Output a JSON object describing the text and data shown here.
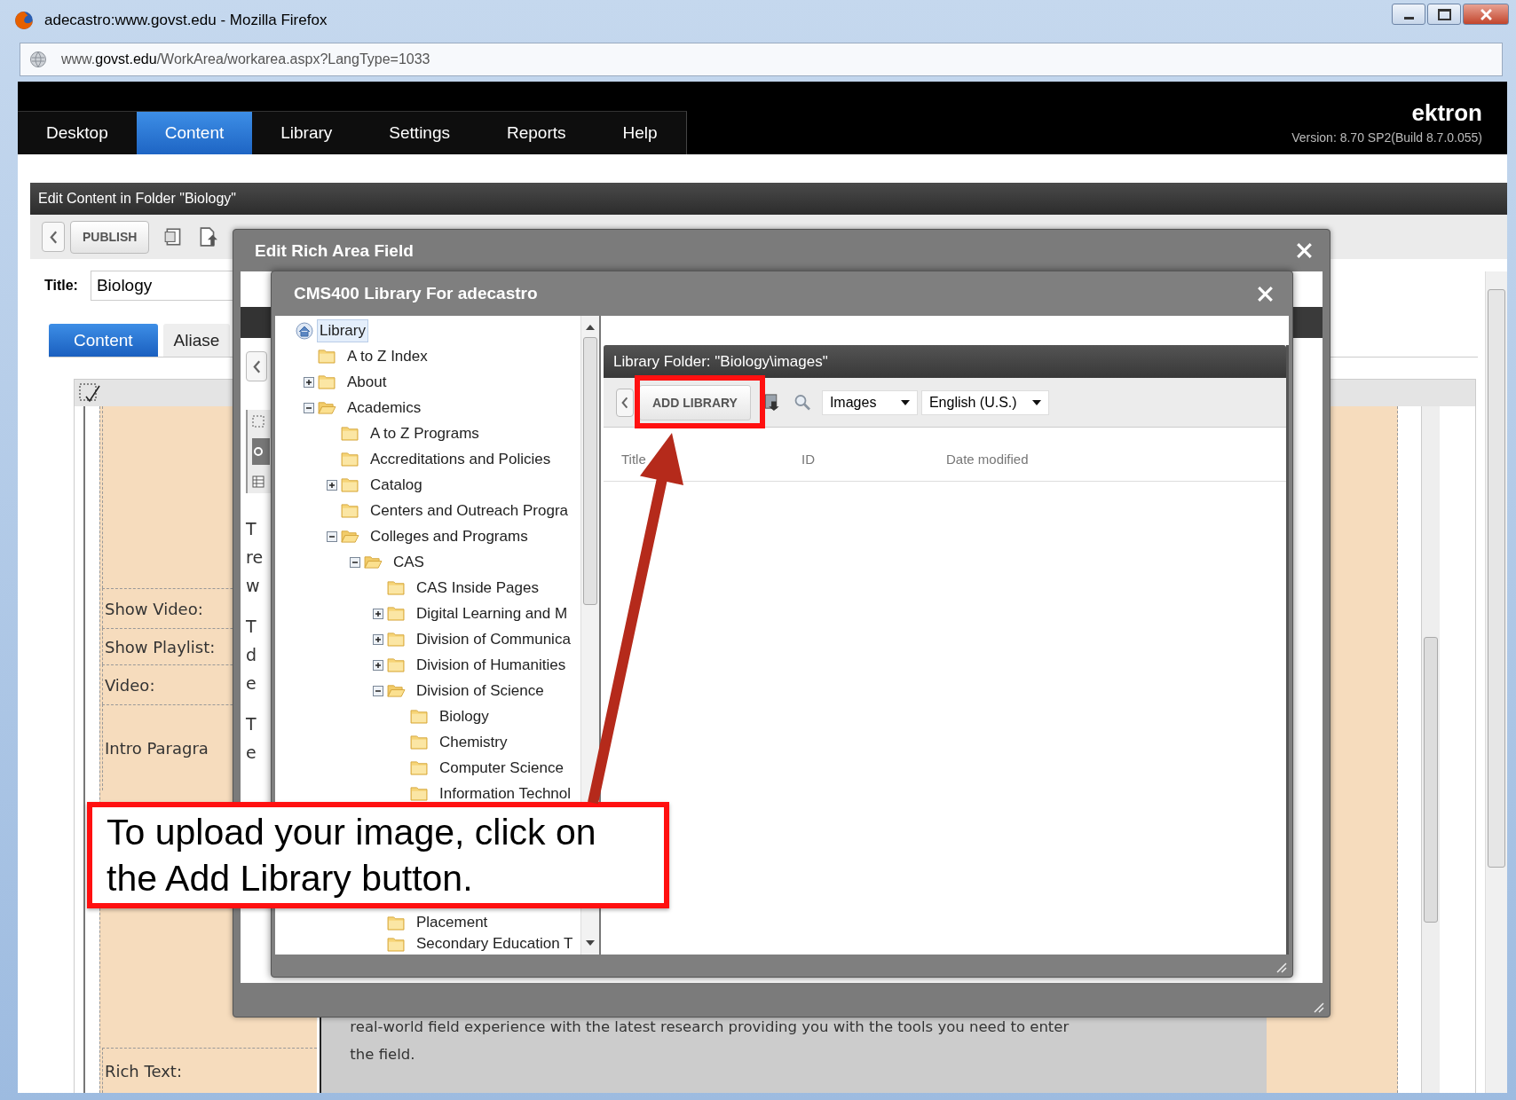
{
  "window": {
    "title": "adecastro:www.govst.edu - Mozilla Firefox"
  },
  "address_bar": {
    "url": "www.**govst.edu**/WorkArea/workarea.aspx?LangType=1033"
  },
  "nav": {
    "tabs": [
      {
        "label": "Desktop",
        "selected": false
      },
      {
        "label": "Content",
        "selected": true
      },
      {
        "label": "Library",
        "selected": false
      },
      {
        "label": "Settings",
        "selected": false
      },
      {
        "label": "Reports",
        "selected": false
      },
      {
        "label": "Help",
        "selected": false
      }
    ],
    "brand": "ektron",
    "version": "Version: 8.70 SP2(Build 8.7.0.055)"
  },
  "page": {
    "header": "Edit Content in Folder \"Biology\"",
    "publish_button": "PUBLISH",
    "title_label": "Title:",
    "title_value": "Biology",
    "tabs": [
      {
        "label": "Content",
        "selected": true
      },
      {
        "label": "Aliase",
        "selected": false
      }
    ],
    "field_labels": [
      "Show Video:",
      "Show Playlist:",
      "Video:",
      "Intro Paragra",
      "Rich Text:"
    ],
    "body_text": "real-world field experience with the latest research providing you with the tools you need to enter\nthe field."
  },
  "rich_area_dialog": {
    "title": "Edit Rich Area Field",
    "text_fragments": [
      [
        "T",
        "re",
        "w"
      ],
      [
        "T",
        "d",
        "e"
      ],
      [
        "T",
        "e"
      ]
    ]
  },
  "library_dialog": {
    "title": "CMS400 Library For adecastro",
    "tree": [
      {
        "label": "Library",
        "selected": true,
        "children": [
          {
            "label": "A to Z Index",
            "selected": false
          },
          {
            "label": "About",
            "selected": false,
            "expanded": false
          },
          {
            "label": "Academics",
            "selected": false,
            "expanded": true,
            "children": [
              {
                "label": "A to Z Programs",
                "selected": false
              },
              {
                "label": "Accreditations and Policies",
                "selected": false
              },
              {
                "label": "Catalog",
                "selected": false,
                "expanded": false
              },
              {
                "label": "Centers and Outreach Progra",
                "selected": false
              },
              {
                "label": "Colleges and Programs",
                "selected": false,
                "expanded": true,
                "children": [
                  {
                    "label": "CAS",
                    "selected": false,
                    "expanded": true,
                    "children": [
                      {
                        "label": "CAS Inside Pages",
                        "selected": false
                      },
                      {
                        "label": "Digital Learning and M",
                        "selected": false,
                        "expanded": false
                      },
                      {
                        "label": "Division of Communica",
                        "selected": false,
                        "expanded": false
                      },
                      {
                        "label": "Division of Humanities",
                        "selected": false,
                        "expanded": false
                      },
                      {
                        "label": "Division of Science",
                        "selected": false,
                        "expanded": true,
                        "children": [
                          {
                            "label": "Biology",
                            "selected": false
                          },
                          {
                            "label": "Chemistry",
                            "selected": false
                          },
                          {
                            "label": "Computer Science",
                            "selected": false
                          },
                          {
                            "label": "Information Technol",
                            "selected": false
                          }
                        ]
                      },
                      {
                        "label": "Placement",
                        "selected": false
                      },
                      {
                        "label": "Secondary Education T",
                        "selected": false
                      }
                    ]
                  }
                ]
              }
            ]
          }
        ]
      }
    ],
    "folder_panel": {
      "title": "Library Folder: \"Biology\\images\"",
      "add_button": "ADD LIBRARY",
      "type_select": "Images",
      "language_select": "English (U.S.)",
      "columns": [
        "Title",
        "ID",
        "Date modified"
      ]
    }
  },
  "callout": {
    "text": "To upload your image, click on\nthe Add Library button."
  }
}
